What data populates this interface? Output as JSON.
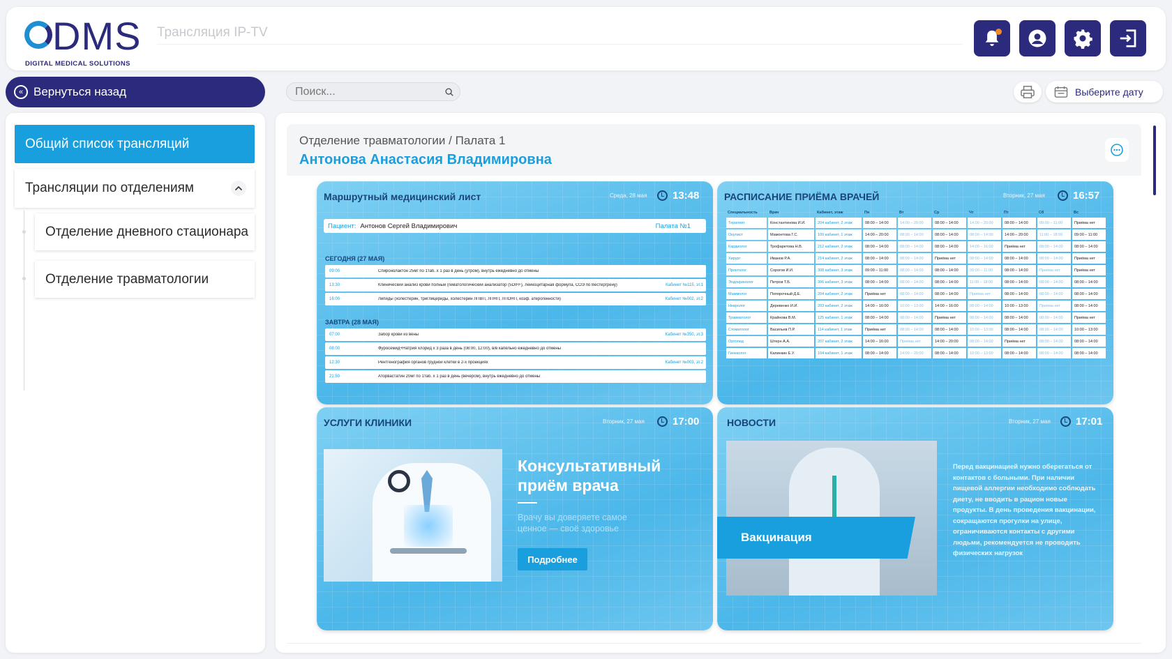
{
  "header": {
    "logo_text": "DMS",
    "logo_subtitle": "DIGITAL MEDICAL SOLUTIONS",
    "app_title": "Трансляция IP-TV"
  },
  "toolbar": {
    "back_label": "Вернуться назад",
    "search_placeholder": "Поиск...",
    "date_label": "Выберите дату"
  },
  "sidebar": {
    "active_item": "Общий список трансляций",
    "group_label": "Трансляции по отделениям",
    "sub_items": [
      "Отделение дневного стационара",
      "Отделение травматологии"
    ]
  },
  "main": {
    "breadcrumb": "Отделение травматологии / Палата 1",
    "patient_name": "Антонова Анастасия Владимировна"
  },
  "route_sheet": {
    "title": "Маршрутный медицинский лист",
    "date": "Среда, 28 мая",
    "time": "13:48",
    "patient_label": "Пациент:",
    "patient_name": "Антонов Сергей Владимирович",
    "room": "Палата №1",
    "today_header": "СЕГОДНЯ (27 МАЯ)",
    "tomorrow_header": "ЗАВТРА (28 МАЯ)",
    "today": [
      {
        "time": "09:00",
        "desc": "Спиронолактон 25мг по 1таб. х 1 раз в день (утром), внутрь ежедневно до отмены",
        "cab": ""
      },
      {
        "time": "13:30",
        "desc": "Клинический анализ крови полный (гематологический анализатор (5DIFF), лейкоцитарная формула, СОЭ по Вестергрену)",
        "cab": "Кабинет №115, эт.1"
      },
      {
        "time": "16:00",
        "desc": "Липиды (холестерин, триглицериды, холестерин ЛПВП, ЛПНП, ЛПОНП, коэф. атерогенности)",
        "cab": "Кабинет №002, эт.2"
      }
    ],
    "tomorrow": [
      {
        "time": "07:00",
        "desc": "Забор крови из вены",
        "cab": "Кабинет №350, эт.3"
      },
      {
        "time": "08:00",
        "desc": "Фуросемид+Натрия хлорид х 3 раза в день (08:00, 12:00), в/в капельно ежедневно до отмены",
        "cab": ""
      },
      {
        "time": "12:30",
        "desc": "Рентгенография органов грудной клетки в 2-х проекциях",
        "cab": "Кабинет №003, эт.2"
      },
      {
        "time": "21:50",
        "desc": "Аторвастатин 20мг по 1таб. х 1 раз в день (вечером), внутрь ежедневно до отмены",
        "cab": ""
      }
    ]
  },
  "schedule": {
    "title": "РАСПИСАНИЕ ПРИЁМА ВРАЧЕЙ",
    "date": "Вторник, 27 мая",
    "time": "16:57",
    "columns": [
      "Специальность",
      "Врач",
      "Кабинет, этаж",
      "Пн",
      "Вт",
      "Ср",
      "Чт",
      "Пт",
      "Сб",
      "Вс"
    ],
    "rows": [
      [
        "Терапевт",
        "Константинова И.И.",
        "204 кабинет, 2 этаж",
        "08:00 – 14:00",
        "14:00 – 20:00",
        "08:00 – 14:00",
        "14:00 – 20:00",
        "08:00 – 14:00",
        "09:00 – 11:00",
        "Приёма нет"
      ],
      [
        "Окулист",
        "Мамонтова Г.С.",
        "100 кабинет, 1 этаж",
        "14:00 – 20:00",
        "08:00 – 14:00",
        "08:00 – 14:00",
        "08:00 – 14:00",
        "14:00 – 20:00",
        "11:00 – 18:00",
        "09:00 – 11:00"
      ],
      [
        "Кардиолог",
        "Трофаретова Н.В.",
        "212 кабинет, 2 этаж",
        "08:00 – 14:00",
        "08:00 – 14:00",
        "08:00 – 14:00",
        "14:00 – 16:00",
        "Приёма нет",
        "08:00 – 14:00",
        "08:00 – 14:00"
      ],
      [
        "Хирург",
        "Иванов Р.А.",
        "214 кабинет, 2 этаж",
        "08:00 – 14:00",
        "08:00 – 14:00",
        "Приёма нет",
        "08:00 – 14:00",
        "08:00 – 14:00",
        "08:00 – 14:00",
        "Приёма нет"
      ],
      [
        "Проктолог",
        "Сорогов И.И.",
        "308 кабинет, 3 этаж",
        "09:00 – 11:00",
        "08:00 – 14:00",
        "08:00 – 14:00",
        "09:00 – 11:00",
        "08:00 – 14:00",
        "Приёма нет",
        "Приёма нет"
      ],
      [
        "Эндокринолог",
        "Петров Т.Б.",
        "306 кабинет, 3 этаж",
        "08:00 – 14:00",
        "08:00 – 14:00",
        "08:00 – 14:00",
        "11:00 – 18:00",
        "08:00 – 14:00",
        "08:00 – 14:00",
        "08:00 – 14:00"
      ],
      [
        "Маммолог",
        "Попорочный Д.Е.",
        "204 кабинет, 2 этаж",
        "Приёма нет",
        "08:00 – 14:00",
        "08:00 – 14:00",
        "Приёма нет",
        "08:00 – 14:00",
        "08:00 – 14:00",
        "08:00 – 14:00"
      ],
      [
        "Невролог",
        "Деревенко И.И.",
        "203 кабинет, 2 этаж",
        "14:00 – 16:00",
        "10:00 – 13:00",
        "14:00 – 16:00",
        "08:00 – 14:00",
        "10:00 – 13:00",
        "Приёма нет",
        "08:00 – 14:00"
      ],
      [
        "Травматолог",
        "Крайнова В.М.",
        "125 кабинет, 1 этаж",
        "08:00 – 14:00",
        "08:00 – 14:00",
        "Приёма нет",
        "08:00 – 14:00",
        "08:00 – 14:00",
        "08:00 – 14:00",
        "Приёма нет"
      ],
      [
        "Стоматолог",
        "Васильев П.Р.",
        "114 кабинет, 1 этаж",
        "Приёма нет",
        "08:00 – 14:00",
        "08:00 – 14:00",
        "10:00 – 13:00",
        "08:00 – 14:00",
        "08:00 – 14:00",
        "10:00 – 13:00"
      ],
      [
        "Ортопед",
        "Штерн А.А.",
        "207 кабинет, 2 этаж",
        "14:00 – 16:00",
        "Приёма нет",
        "14:00 – 20:00",
        "08:00 – 14:00",
        "Приёма нет",
        "08:00 – 14:00",
        "08:00 – 14:00"
      ],
      [
        "Гинеколог",
        "Калинкин Е.У.",
        "104 кабинет, 1 этаж",
        "08:00 – 14:00",
        "14:00 – 20:00",
        "08:00 – 14:00",
        "10:00 – 13:00",
        "08:00 – 14:00",
        "08:00 – 14:00",
        "08:00 – 14:00"
      ]
    ]
  },
  "services": {
    "title": "УСЛУГИ КЛИНИКИ",
    "date": "Вторник, 27 мая",
    "time": "17:00",
    "headline": "Консультативный приём врача",
    "text": "Врачу вы доверяете самое ценное — своё здоровье",
    "button": "Подробнее"
  },
  "news": {
    "title": "НОВОСТИ",
    "date": "Вторник, 27 мая",
    "time": "17:01",
    "banner": "Вакцинация",
    "text": "Перед вакцинацией нужно оберегаться от контактов с больными. При наличии пищевой аллергии необходимо соблюдать диету, не вводить в рацион новые продукты. В день проведения вакцинации, сокращаются прогулки на улице, ограничиваются контакты с другими людьми, рекомендуется не проводить физических нагрузок"
  },
  "colors": {
    "brand": "#2b2a7c",
    "accent": "#1a9fde",
    "notification": "#f08a24"
  },
  "icons": [
    "bell-icon",
    "user-icon",
    "gear-icon",
    "logout-icon",
    "back-arrow-icon",
    "search-icon",
    "print-icon",
    "calendar-icon",
    "chevron-up-icon",
    "more-icon",
    "clock-icon"
  ]
}
